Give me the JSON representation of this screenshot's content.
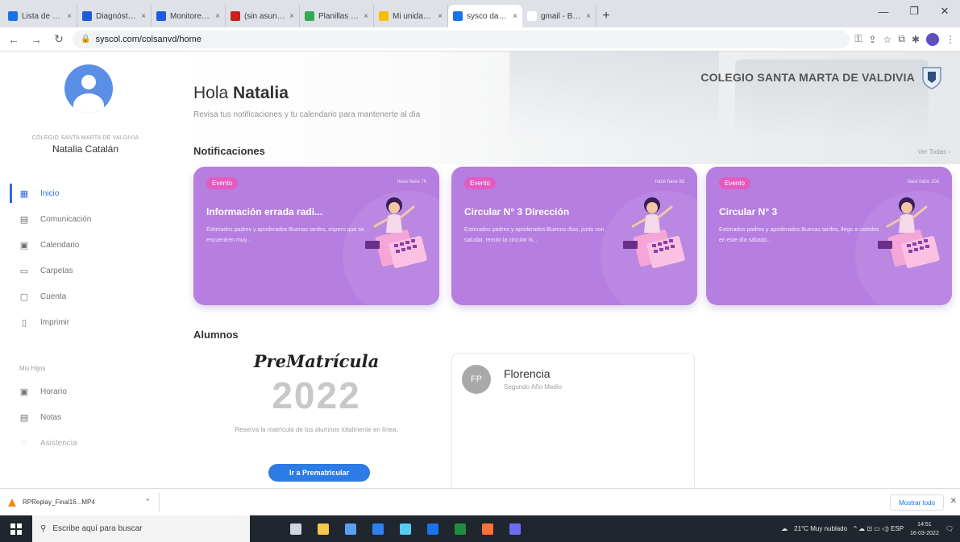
{
  "browser": {
    "tabs": [
      {
        "label": "Lista de usuarios",
        "color": "#1a73e8",
        "active": false
      },
      {
        "label": "Diagnóstico inte",
        "color": "#1e5bd8",
        "active": false
      },
      {
        "label": "Monitoreo del Cl",
        "color": "#1e5bd8",
        "active": false
      },
      {
        "label": "(sin asunto) - ec",
        "color": "#c5221f",
        "active": false
      },
      {
        "label": "Planillas - Goo",
        "color": "#34a853",
        "active": false
      },
      {
        "label": "Mi unidad - Goo",
        "color": "#fbbc04",
        "active": false
      },
      {
        "label": "sysco datos SN",
        "color": "#1a73e8",
        "active": true
      },
      {
        "label": "gmail - Búsqued",
        "color": "#ffffff",
        "active": false
      }
    ],
    "url": "syscol.com/colsanvd/home",
    "new_tab": "+",
    "tab_close": "×",
    "win_min": "—",
    "win_max": "❐",
    "win_close": "✕",
    "profile_letter": "N"
  },
  "sidebar": {
    "school_small": "COLEGIO SANTA MARTA DE VALDIVIA",
    "user_name": "Natalia Catalán",
    "menu": [
      {
        "label": "Inicio",
        "icon": "▦",
        "active": true
      },
      {
        "label": "Comunicación",
        "icon": "▤",
        "active": false
      },
      {
        "label": "Calendario",
        "icon": "▣",
        "active": false
      },
      {
        "label": "Carpetas",
        "icon": "▭",
        "active": false
      },
      {
        "label": "Cuenta",
        "icon": "▢",
        "active": false
      },
      {
        "label": "Imprimir",
        "icon": "▯",
        "active": false
      }
    ],
    "section_label": "Mis Hijos",
    "menu2": [
      {
        "label": "Horario",
        "icon": "▣"
      },
      {
        "label": "Notas",
        "icon": "▤"
      },
      {
        "label": "Asistencia",
        "icon": "◌"
      }
    ]
  },
  "main": {
    "greeting_prefix": "Hola ",
    "greeting_name": "Natalia",
    "greeting_sub": "Revisa tus notificaciones y tu calendario para mantenerte al día",
    "school_title": "COLEGIO SANTA MARTA DE VALDIVIA",
    "notifications_title": "Notificaciones",
    "see_all": "Ver Todas ›",
    "cards": [
      {
        "badge": "Evento",
        "time": "hace hace 7h",
        "title": "Información errada radi...",
        "body": "Estimados padres y apoderados:Buenas tardes, espero que se encuentren muy..."
      },
      {
        "badge": "Evento",
        "time": "hace hace 8d",
        "title": "Circular N° 3 Dirección",
        "body": "Estimados padres y apoderados:Buenos días, junto con saludar, remito la circular N..."
      },
      {
        "badge": "Evento",
        "time": "hace hace 10d",
        "title": "Circular N° 3",
        "body": "Estimados padres y apoderados:Buenas tardes, llego a ustedes en este día sábado..."
      }
    ],
    "students_title": "Alumnos",
    "promo": {
      "title": "PreMatrícula",
      "year": "2022",
      "text": "Reserva la matrícula de tus alumnos totalmente en línea.",
      "button": "Ir a Prematricular"
    },
    "student": {
      "initials": "FP",
      "name": "Florencia",
      "grade": "Segundo Año Medio"
    }
  },
  "downloads": {
    "file": "RPReplay_Final16...MP4",
    "chevron": "⌃",
    "show_all": "Mostrar todo",
    "close": "✕"
  },
  "taskbar": {
    "search_placeholder": "Escribe aquí para buscar",
    "weather": "21°C  Muy nublado",
    "tray_icons": "^ ☁ ⊡ ▭ ◁) ESP",
    "time": "14:51",
    "date": "16-03-2022",
    "apps": [
      {
        "name": "task-view",
        "color": "#cfd6df"
      },
      {
        "name": "file-explorer",
        "color": "#f2c94c"
      },
      {
        "name": "store",
        "color": "#5aa0f0"
      },
      {
        "name": "mail",
        "color": "#2f80ed"
      },
      {
        "name": "photos",
        "color": "#56ccf2"
      },
      {
        "name": "chrome",
        "color": "#1a73e8"
      },
      {
        "name": "excel",
        "color": "#1e8e3e"
      },
      {
        "name": "firefox",
        "color": "#ff7139"
      },
      {
        "name": "teams",
        "color": "#6b6cf0"
      }
    ]
  }
}
